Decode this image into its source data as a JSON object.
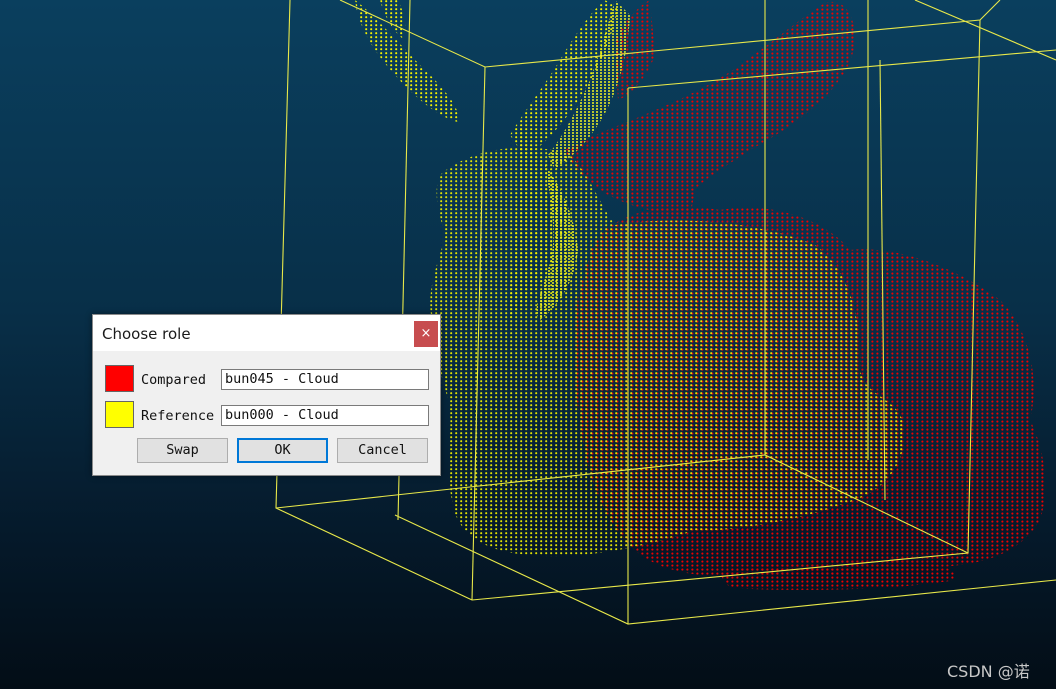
{
  "scene": {
    "reference_cloud_color": "#ffff00",
    "compared_cloud_color": "#ff0000",
    "bounding_box_color": "#ffff00"
  },
  "dialog": {
    "title": "Choose role",
    "close_glyph": "×",
    "rows": [
      {
        "color": "#ff0000",
        "label": "Compared",
        "value": "bun045 - Cloud"
      },
      {
        "color": "#ffff00",
        "label": "Reference",
        "value": "bun000 - Cloud"
      }
    ],
    "buttons": {
      "swap": "Swap",
      "ok": "OK",
      "cancel": "Cancel"
    }
  },
  "watermark": "CSDN @诺"
}
